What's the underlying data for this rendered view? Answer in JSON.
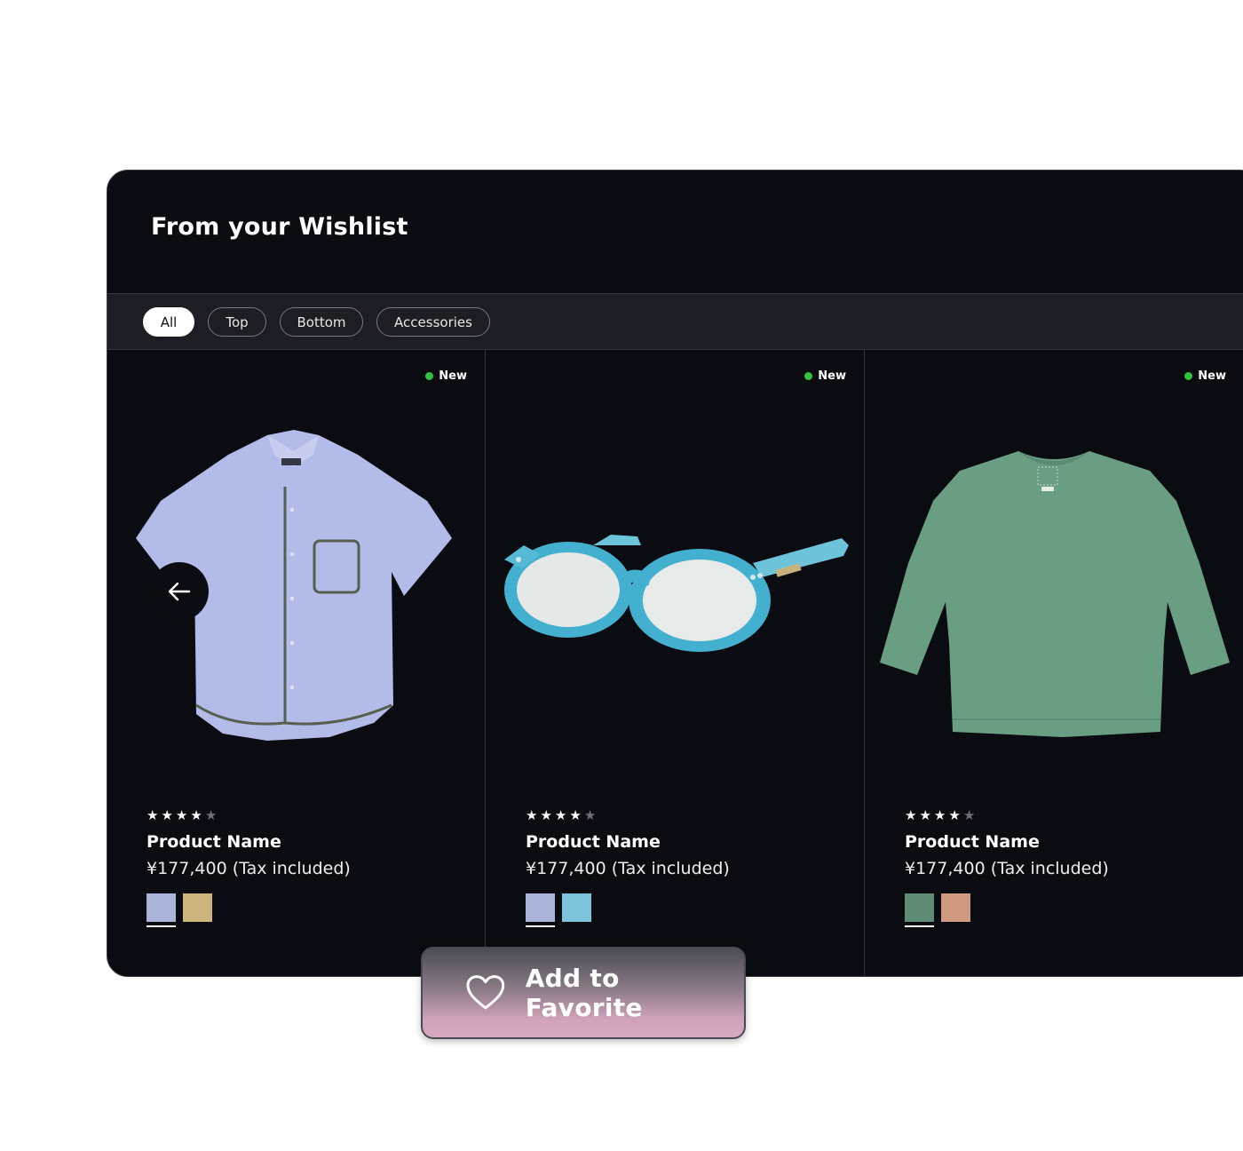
{
  "wishlist": {
    "title": "From your Wishlist",
    "filters": [
      {
        "label": "All",
        "active": true
      },
      {
        "label": "Top",
        "active": false
      },
      {
        "label": "Bottom",
        "active": false
      },
      {
        "label": "Accessories",
        "active": false
      }
    ],
    "products": [
      {
        "badge": "New",
        "image": "shirt",
        "rating": 4,
        "max_rating": 5,
        "name": "Product Name",
        "price": "¥177,400 (Tax included)",
        "swatches": [
          "#aab4d8",
          "#cdb67e"
        ],
        "selected_swatch": 0
      },
      {
        "badge": "New",
        "image": "glasses",
        "rating": 4,
        "max_rating": 5,
        "name": "Product Name",
        "price": "¥177,400 (Tax included)",
        "swatches": [
          "#aab4d8",
          "#7cc4dc"
        ],
        "selected_swatch": 0
      },
      {
        "badge": "New",
        "image": "sweater",
        "rating": 4,
        "max_rating": 5,
        "name": "Product Name",
        "price": "¥177,400 (Tax included)",
        "swatches": [
          "#5f8b74",
          "#cf9880"
        ],
        "selected_swatch": 0
      }
    ]
  },
  "carousel": {
    "prev_icon": "arrow-left-icon"
  },
  "favorite_button": {
    "label": "Add to Favorite",
    "icon": "heart-icon"
  },
  "colors": {
    "panel_bg": "#0b0c11",
    "badge_new": "#31c23f",
    "filter_bar_bg": "#1d1e24"
  }
}
